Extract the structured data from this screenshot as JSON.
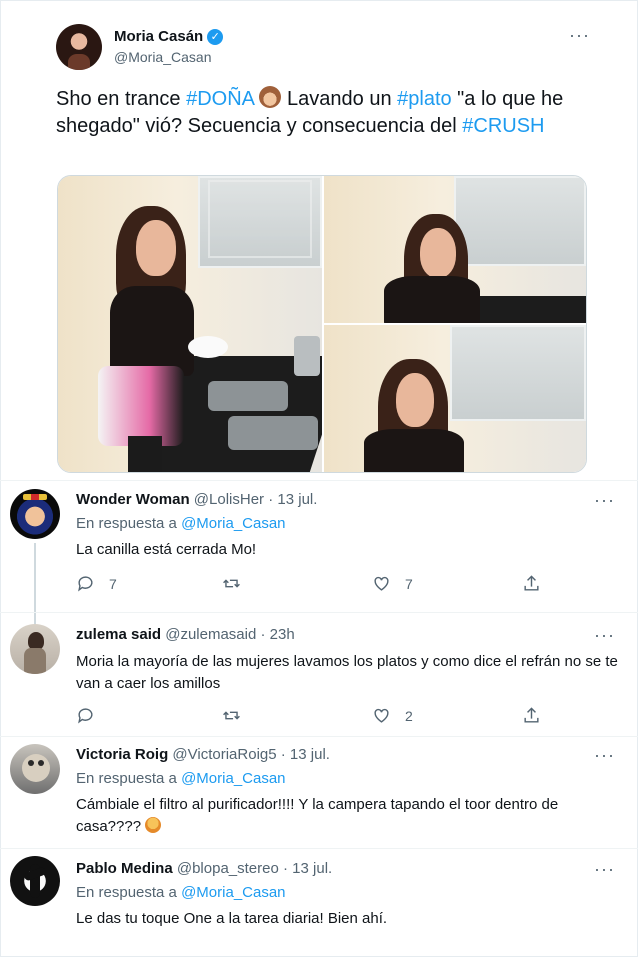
{
  "main_tweet": {
    "author_name": "Moria Casán",
    "author_handle": "@Moria_Casan",
    "text_parts": [
      {
        "t": "Sho en trance ",
        "tag": false
      },
      {
        "t": "#DOÑA",
        "tag": true
      },
      {
        "t": " ",
        "tag": false
      },
      {
        "t": " Lavando un ",
        "tag": false
      },
      {
        "t": "#plato",
        "tag": true
      },
      {
        "t": " \"a lo que he shegado\" vió? Secuencia y consecuencia del ",
        "tag": false
      },
      {
        "t": "#CRUSH",
        "tag": true
      }
    ],
    "media_count": 3
  },
  "replies": [
    {
      "name": "Wonder Woman",
      "handle": "@LolisHer",
      "date": "· 13 jul.",
      "reply_prefix": "En respuesta a",
      "reply_to": "@Moria_Casan",
      "text": "La canilla está cerrada Mo!",
      "comments": "7",
      "retweets": "",
      "likes": "7"
    },
    {
      "name": "zulema said",
      "handle": "@zulemasaid",
      "date": "· 23h",
      "reply_prefix": "",
      "reply_to": "",
      "text": "Moria la mayoría de las mujeres lavamos los platos y como dice el refrán no se te van a caer los amillos",
      "comments": "",
      "retweets": "",
      "likes": "2"
    },
    {
      "name": "Victoria Roig",
      "handle": "@VictoriaRoig5",
      "date": "· 13 jul.",
      "reply_prefix": "En respuesta a",
      "reply_to": "@Moria_Casan",
      "text": "Cámbiale el filtro al purificador!!!! Y la campera tapando el toor dentro de casa????"
    },
    {
      "name": "Pablo Medina",
      "handle": "@blopa_stereo",
      "date": "· 13 jul.",
      "reply_prefix": "En respuesta a",
      "reply_to": "@Moria_Casan",
      "text": "Le das tu toque One a la tarea diaria! Bien ahí."
    }
  ],
  "colors": {
    "link": "#1d9bf0",
    "secondary_text": "#536471",
    "primary_text": "#0f1419",
    "verified": "#1d9bf0"
  },
  "icons": [
    "verified-badge-icon",
    "more-dots-icon",
    "reply-icon",
    "retweet-icon",
    "like-icon",
    "share-icon"
  ]
}
